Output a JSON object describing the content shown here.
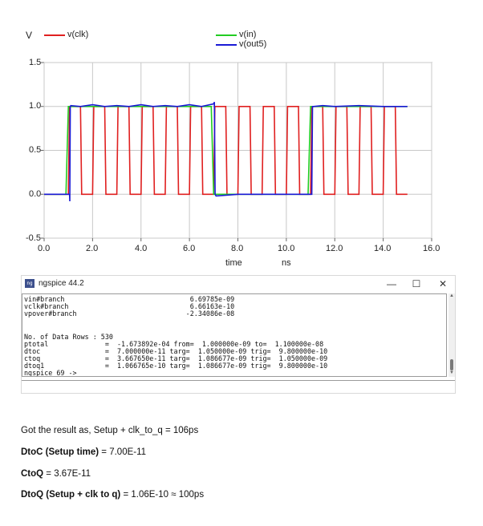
{
  "chart_data": {
    "type": "line",
    "y_unit": "V",
    "xlabel": "time",
    "xunit": "ns",
    "xlim": [
      0,
      16
    ],
    "ylim": [
      -0.5,
      1.5
    ],
    "x_ticks": [
      "0.0",
      "2.0",
      "4.0",
      "6.0",
      "8.0",
      "10.0",
      "12.0",
      "14.0",
      "16.0"
    ],
    "y_ticks": [
      "1.5",
      "1.0",
      "0.5",
      "0.0",
      "-0.5"
    ],
    "grid": true,
    "legend": [
      {
        "name": "v(clk)",
        "color": "#e02020"
      },
      {
        "name": "v(in)",
        "color": "#22cc22"
      },
      {
        "name": "v(out5)",
        "color": "#1a1ad6"
      }
    ],
    "series": [
      {
        "name": "v(clk)",
        "color": "#e02020",
        "x": [
          0,
          1,
          1.05,
          1.5,
          1.55,
          2,
          2.05,
          2.5,
          2.55,
          3,
          3.05,
          3.5,
          3.55,
          4,
          4.05,
          4.5,
          4.55,
          5,
          5.05,
          5.5,
          5.55,
          6,
          6.05,
          6.5,
          6.55,
          7,
          7.05,
          7.5,
          7.55,
          8,
          8.05,
          8.5,
          8.55,
          9,
          9.05,
          9.5,
          9.55,
          10,
          10.05,
          10.5,
          10.55,
          11,
          11.05,
          11.5,
          11.55,
          12,
          12.05,
          12.5,
          12.55,
          13,
          13.05,
          13.5,
          13.55,
          14,
          14.05,
          14.5,
          14.55,
          15
        ],
        "y": [
          0,
          0,
          1,
          1,
          0,
          0,
          1,
          1,
          0,
          0,
          1,
          1,
          0,
          0,
          1,
          1,
          0,
          0,
          1,
          1,
          0,
          0,
          1,
          1,
          0,
          0,
          1,
          1,
          0,
          0,
          1,
          1,
          0,
          0,
          1,
          1,
          0,
          0,
          1,
          1,
          0,
          0,
          1,
          1,
          0,
          0,
          1,
          1,
          0,
          0,
          1,
          1,
          0,
          0,
          1,
          1,
          0,
          0
        ]
      },
      {
        "name": "v(in)",
        "color": "#22cc22",
        "x": [
          0,
          0.9,
          1.0,
          6.9,
          7.0,
          10.9,
          11.0,
          15
        ],
        "y": [
          0,
          0,
          1,
          1,
          0,
          0,
          1,
          1
        ]
      },
      {
        "name": "v(out5)",
        "color": "#1a1ad6",
        "x": [
          0,
          1.05,
          1.06,
          1.08,
          1.1,
          1.5,
          2.0,
          2.5,
          3.0,
          3.5,
          4.0,
          4.5,
          5.0,
          5.5,
          6.0,
          6.5,
          7.0,
          7.03,
          7.06,
          7.1,
          8.0,
          9.0,
          10.0,
          11.0,
          11.05,
          11.08,
          11.12,
          11.5,
          12.0,
          13.0,
          14.0,
          15.0
        ],
        "y": [
          0,
          0,
          -0.08,
          1.0,
          1.01,
          1.0,
          1.02,
          1.0,
          1.01,
          1.0,
          1.02,
          1.0,
          1.01,
          1.0,
          1.02,
          1.0,
          1.03,
          1.05,
          0.0,
          -0.02,
          0,
          0,
          0,
          0,
          0.0,
          1.0,
          1.0,
          1.01,
          1.0,
          1.01,
          1.0,
          1.0
        ]
      }
    ]
  },
  "ngspice": {
    "title": "ngspice 44.2",
    "icon_text": "ng",
    "console_lines": [
      "vin#branch                               6.69785e-09",
      "vclk#branch                              6.66163e-10",
      "vpover#branch                           -2.34086e-08",
      "",
      "No. of Data Rows : 530",
      "ptotal              =  -1.673892e-04 from=  1.000000e-09 to=  1.100000e-08",
      "dtoc                =  7.000000e-11 targ=  1.050000e-09 trig=  9.800000e-10",
      "ctoq                =  3.667650e-11 targ=  1.086677e-09 trig=  1.050000e-09",
      "dtoq1               =  1.066765e-10 targ=  1.086677e-09 trig=  9.800000e-10",
      "ngspice 69 ->"
    ],
    "minimize": "—",
    "maximize": "☐",
    "close": "✕"
  },
  "notes": {
    "line1": "Got the result as, Setup + clk_to_q = 106ps",
    "line2_bold": "DtoC (Setup time)",
    "line2_rest": " = 7.00E-11",
    "line3_bold": "CtoQ",
    "line3_rest": " = 3.67E-11",
    "line4_bold": "DtoQ (Setup + clk to q)",
    "line4_rest": " = 1.06E-10 ≈ 100ps"
  }
}
